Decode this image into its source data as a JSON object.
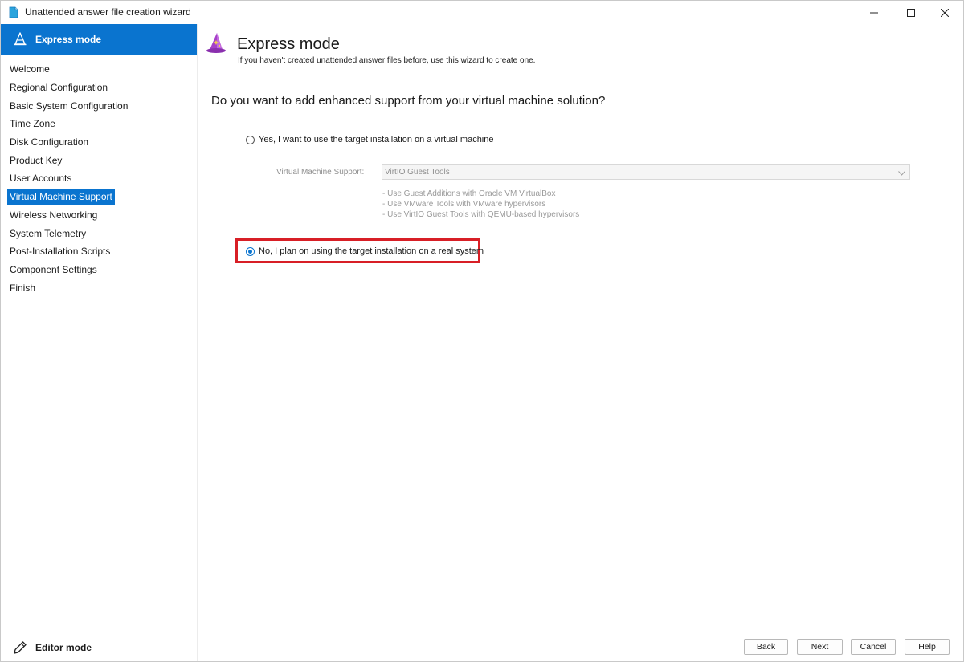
{
  "window": {
    "title": "Unattended answer file creation wizard"
  },
  "sidebar": {
    "header": "Express mode",
    "items": [
      {
        "label": "Welcome",
        "active": false
      },
      {
        "label": "Regional Configuration",
        "active": false
      },
      {
        "label": "Basic System Configuration",
        "active": false
      },
      {
        "label": "Time Zone",
        "active": false
      },
      {
        "label": "Disk Configuration",
        "active": false
      },
      {
        "label": "Product Key",
        "active": false
      },
      {
        "label": "User Accounts",
        "active": false
      },
      {
        "label": "Virtual Machine Support",
        "active": true
      },
      {
        "label": "Wireless Networking",
        "active": false
      },
      {
        "label": "System Telemetry",
        "active": false
      },
      {
        "label": "Post-Installation Scripts",
        "active": false
      },
      {
        "label": "Component Settings",
        "active": false
      },
      {
        "label": "Finish",
        "active": false
      }
    ],
    "footer": "Editor mode"
  },
  "main": {
    "title": "Express mode",
    "subtitle": "If you haven't created unattended answer files before, use this wizard to create one.",
    "question": "Do you want to add enhanced support from your virtual machine solution?",
    "option_yes": {
      "label": "Yes, I want to use the target installation on a virtual machine",
      "checked": false
    },
    "vm_support_label": "Virtual Machine Support:",
    "vm_support_value": "VirtIO Guest Tools",
    "hints": [
      "- Use Guest Additions with Oracle VM VirtualBox",
      "- Use VMware Tools with VMware hypervisors",
      "- Use VirtIO Guest Tools with QEMU-based hypervisors"
    ],
    "option_no": {
      "label": "No, I plan on using the target installation on a real system",
      "checked": true
    }
  },
  "buttons": {
    "back": "Back",
    "next": "Next",
    "cancel": "Cancel",
    "help": "Help"
  },
  "colors": {
    "accent": "#0a74cf",
    "highlight": "#d81f26",
    "wizard_icon": "#a640c8"
  },
  "icons": {
    "app": "document-icon",
    "express": "wizard-hat-icon",
    "editor": "pencil-icon",
    "minimize": "minimize-icon",
    "maximize": "maximize-icon",
    "close": "close-icon"
  }
}
